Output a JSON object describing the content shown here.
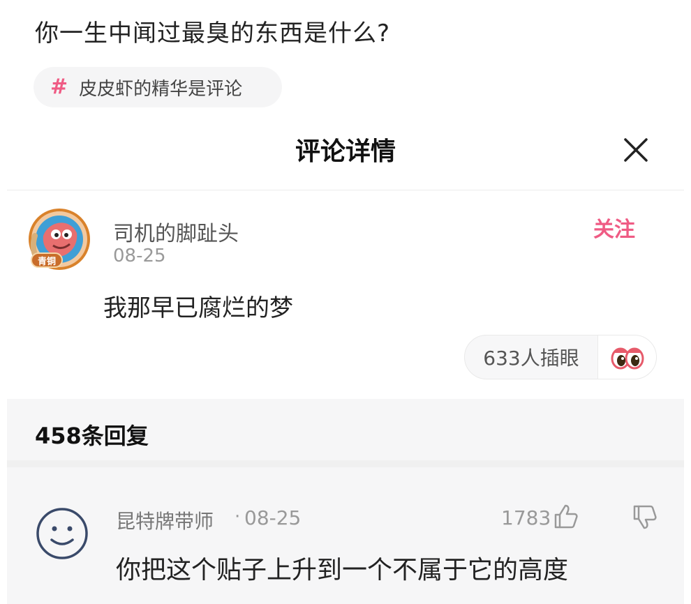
{
  "post": {
    "title": "你一生中闻过最臭的东西是什么?",
    "topic_tag": {
      "icon": "hash-icon",
      "label": "皮皮虾的精华是评论"
    }
  },
  "comment_panel": {
    "title": "评论详情",
    "close_icon": "close-icon",
    "author": {
      "name": "司机的脚趾头",
      "date": "08-25",
      "avatar_badge_text": "青铜"
    },
    "follow_label": "关注",
    "content": "我那早已腐烂的梦",
    "reaction": {
      "count_label": "633人插眼",
      "icon": "eyes-icon"
    }
  },
  "replies": {
    "count_label": "458条回复",
    "items": [
      {
        "user": "昆特牌带师",
        "dot": "·",
        "date": "08-25",
        "likes": "1783",
        "content": "你把这个贴子上升到一个不属于它的高度",
        "avatar_icon": "smiley-avatar-icon"
      }
    ]
  },
  "colors": {
    "accent": "#ef5b84",
    "reply_background": "#f6f6f7"
  }
}
